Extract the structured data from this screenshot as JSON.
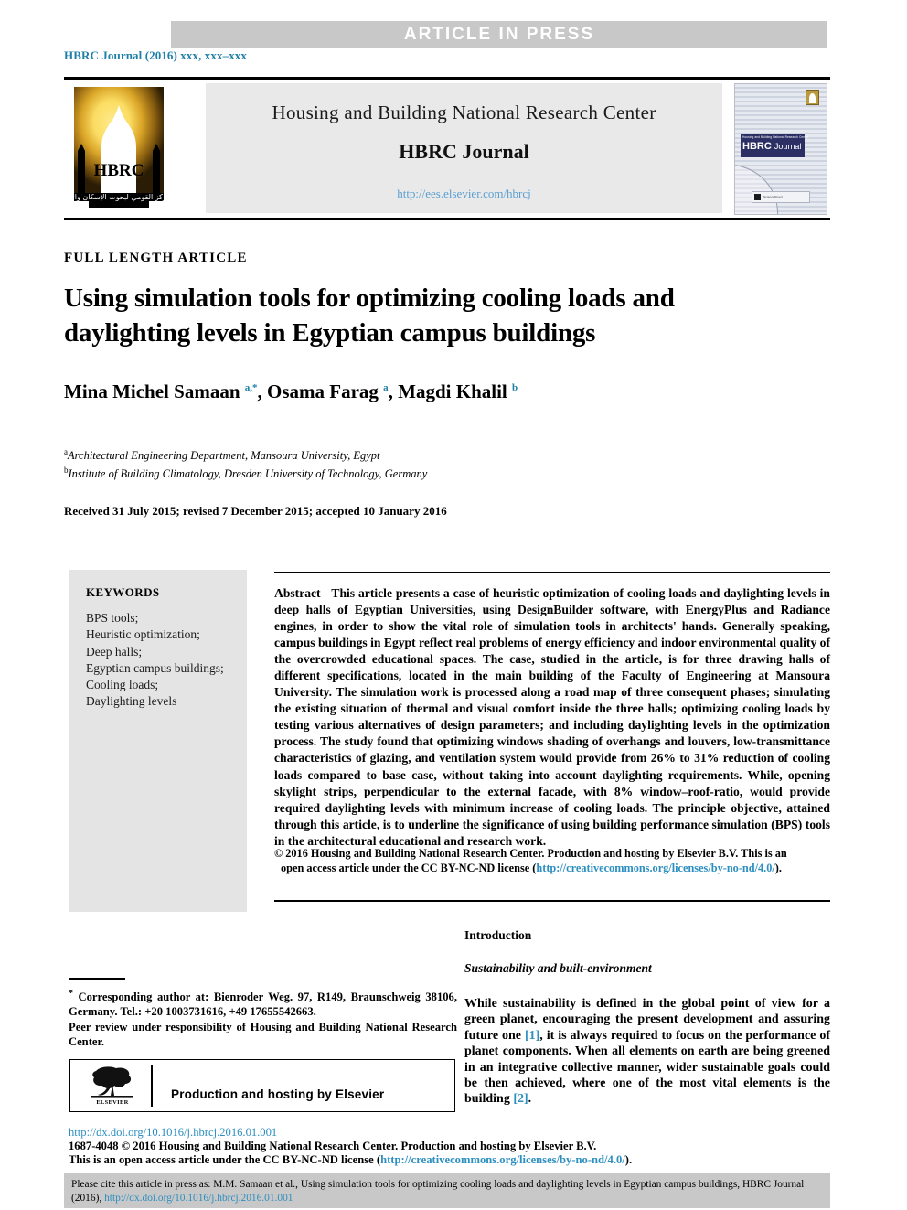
{
  "banner": {
    "press_label": "ARTICLE  IN  PRESS"
  },
  "journal_line": "HBRC Journal (2016) xxx, xxx–xxx",
  "masthead": {
    "logo_text": "HBRC",
    "logo_arabic": "المركز القومي لبحوث الإسكان والبناء",
    "organization": "Housing and Building National Research Center",
    "journal_name": "HBRC Journal",
    "url": "http://ees.elsevier.com/hbrcj",
    "cover": {
      "small_title": "Housing and Building National Research Center",
      "main_title": "HBRC",
      "main_title_light": "Journal",
      "strip_text": "ScienceDirect"
    }
  },
  "article": {
    "type": "FULL LENGTH ARTICLE",
    "title": "Using simulation tools for optimizing cooling loads and daylighting levels in Egyptian campus buildings",
    "authors_html": "Mina Michel Samaan <sup>a,*</sup>, Osama Farag <sup>a</sup>, Magdi Khalil <sup>b</sup>",
    "affiliation_a": "Architectural Engineering Department, Mansoura University, Egypt",
    "affiliation_b": "Institute of Building Climatology, Dresden University of Technology, Germany",
    "received": "Received 31 July 2015; revised 7 December 2015; accepted 10 January 2016"
  },
  "keywords": {
    "heading": "KEYWORDS",
    "items": [
      "BPS tools;",
      "Heuristic optimization;",
      "Deep halls;",
      "Egyptian campus buildings;",
      "Cooling loads;",
      "Daylighting levels"
    ]
  },
  "abstract": {
    "label": "Abstract",
    "body": "This article presents a case of heuristic optimization of cooling loads and daylighting levels in deep halls of Egyptian Universities, using DesignBuilder software, with EnergyPlus and Radiance engines, in order to show the vital role of simulation tools in architects' hands. Generally speaking, campus buildings in Egypt reflect real problems of energy efficiency and indoor environmental quality of the overcrowded educational spaces. The case, studied in the article, is for three drawing halls of different specifications, located in the main building of the Faculty of Engineering at Mansoura University. The simulation work is processed along a road map of three consequent phases; simulating the existing situation of thermal and visual comfort inside the three halls; optimizing cooling loads by testing various alternatives of design parameters; and including daylighting levels in the optimization process. The study found that optimizing windows shading of overhangs and louvers, low-transmittance characteristics of glazing, and ventilation system would provide from 26% to 31% reduction of cooling loads compared to base case, without taking into account daylighting requirements. While, opening skylight strips, perpendicular to the external facade, with 8% window–roof-ratio, would provide required daylighting levels with minimum increase of cooling loads. The principle objective, attained through this article, is to underline the significance of using building performance simulation (BPS) tools in the architectural educational and research work.",
    "copyright_line1": "© 2016 Housing and Building National Research Center. Production and hosting by Elsevier B.V. This is an",
    "copyright_line2_pre": "open access article under the CC BY-NC-ND license (",
    "copyright_license_url": "http://creativecommons.org/licenses/by-no-nd/4.0/",
    "copyright_line2_post": ")."
  },
  "introduction": {
    "heading": "Introduction",
    "subheading": "Sustainability and built-environment",
    "paragraph_pre": "While sustainability is defined in the global point of view for a green planet, encouraging the present development and assuring future one ",
    "citation_1": "[1]",
    "paragraph_mid": ", it is always required to focus on the performance of planet components. When all elements on earth are being greened in an integrative collective manner, wider sustainable goals could be then achieved, where one of the most vital elements is the building ",
    "citation_2": "[2]",
    "paragraph_post": "."
  },
  "footnote": {
    "star": "*",
    "corresponding": "Corresponding author at: Bienroder Weg. 97, R149, Braunschweig 38106, Germany. Tel.: +20 1003731616, +49 17655542663.",
    "peer_review": "Peer review under responsibility of Housing and Building National Research Center."
  },
  "elsevier_box": {
    "logo_word": "ELSEVIER",
    "text": "Production and hosting by Elsevier"
  },
  "footer": {
    "doi": "http://dx.doi.org/10.1016/j.hbrcj.2016.01.001",
    "line1": "1687-4048 © 2016 Housing and Building National Research Center. Production and hosting by Elsevier B.V.",
    "line2_pre": "This is an open access article under the CC BY-NC-ND license (",
    "license_url": "http://creativecommons.org/licenses/by-no-nd/4.0/",
    "line2_post": ")."
  },
  "cite_bar": {
    "text_pre": "Please cite this article in press as: M.M. Samaan et al., Using simulation tools for optimizing cooling loads and daylighting levels in Egyptian campus buildings, HBRC Journal (2016), ",
    "link": "http://dx.doi.org/10.1016/j.hbrcj.2016.01.001"
  },
  "colors": {
    "banner_gray": "#c8c8c8",
    "link_blue": "#2d8fc0",
    "journal_teal": "#1f7fa8",
    "keywords_gray": "#e4e4e4",
    "masthead_gray": "#e9e9e9"
  }
}
